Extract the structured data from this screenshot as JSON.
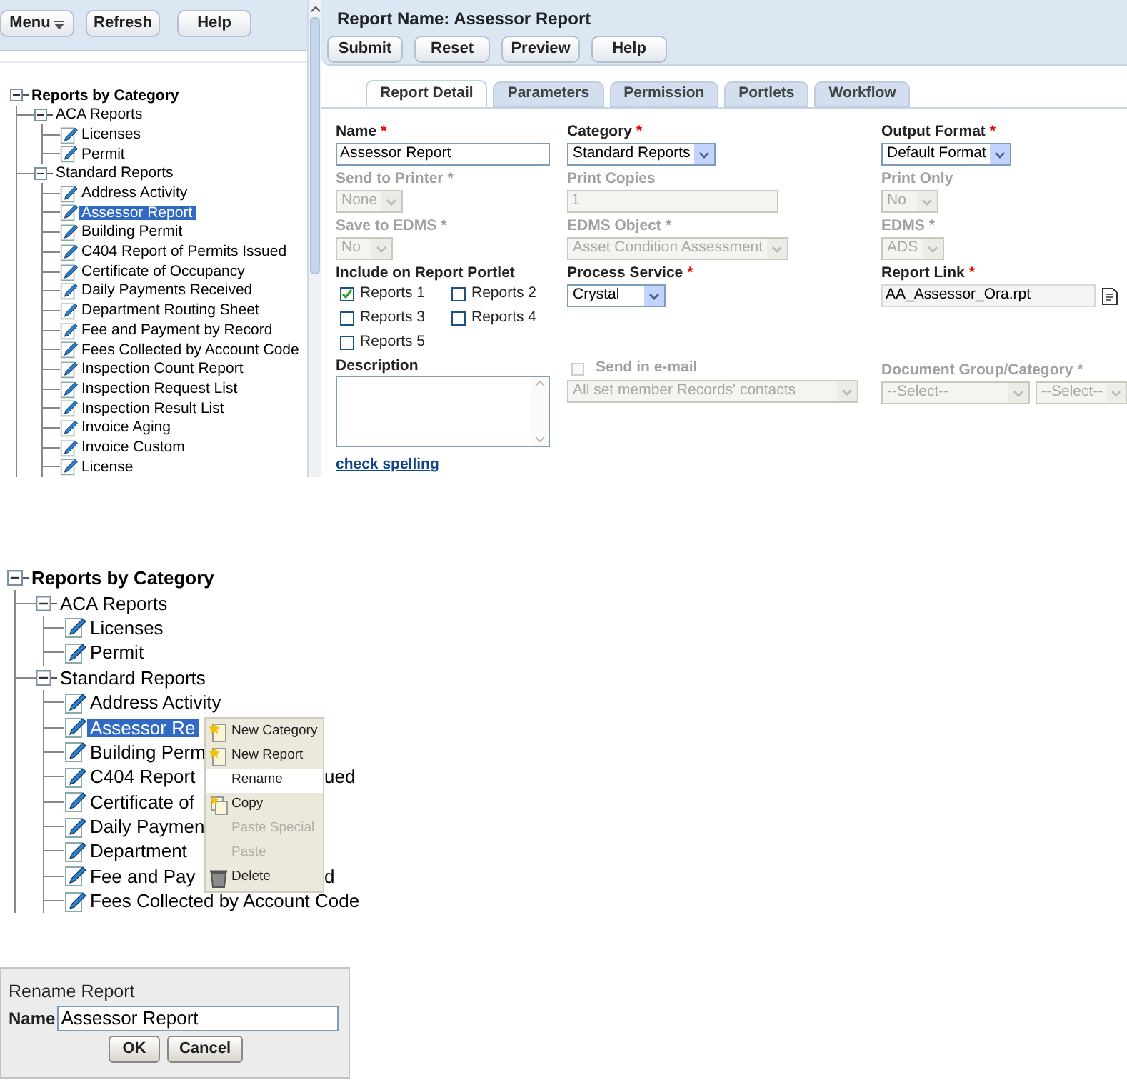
{
  "toolbar": [
    {
      "label": "Menu",
      "kind": "dropdown"
    },
    {
      "label": "Refresh",
      "kind": "button"
    },
    {
      "label": "Help",
      "kind": "button"
    }
  ],
  "tree": {
    "label": "Reports by Category",
    "expanded": true,
    "children": [
      {
        "label": "ACA Reports",
        "expanded": true,
        "children": [
          {
            "label": "Licenses",
            "selected": false
          },
          {
            "label": "Permit",
            "selected": false
          }
        ]
      },
      {
        "label": "Standard Reports",
        "expanded": true,
        "children": [
          {
            "label": "Address Activity",
            "selected": false
          },
          {
            "label": "Assessor Report",
            "selected": true
          },
          {
            "label": "Building Permit",
            "selected": false
          },
          {
            "label": "C404 Report of Permits Issued",
            "selected": false
          },
          {
            "label": "Certificate of Occupancy",
            "selected": false
          },
          {
            "label": "Daily Payments Received",
            "selected": false
          },
          {
            "label": "Department Routing Sheet",
            "selected": false
          },
          {
            "label": "Fee and Payment by Record",
            "selected": false
          },
          {
            "label": "Fees Collected by Account Code",
            "selected": false
          },
          {
            "label": "Inspection Count Report",
            "selected": false
          },
          {
            "label": "Inspection Request List",
            "selected": false
          },
          {
            "label": "Inspection Result List",
            "selected": false
          },
          {
            "label": "Invoice Aging",
            "selected": false
          },
          {
            "label": "Invoice Custom",
            "selected": false
          },
          {
            "label": "License",
            "selected": false
          }
        ]
      }
    ]
  },
  "report": {
    "title": "Report Name: Assessor Report",
    "buttons": [
      "Submit",
      "Reset",
      "Preview",
      "Help"
    ],
    "tabs": [
      {
        "label": "Report Detail",
        "selected": true
      },
      {
        "label": "Parameters",
        "selected": false
      },
      {
        "label": "Permission",
        "selected": false
      },
      {
        "label": "Portlets",
        "selected": false
      },
      {
        "label": "Workflow",
        "selected": false
      }
    ],
    "fields": [
      {
        "kind": "text",
        "label": "Name",
        "required_mark": "*",
        "disabled": false,
        "value": "Assessor Report"
      },
      {
        "kind": "select",
        "label": "Category",
        "required_mark": "*",
        "disabled": false,
        "value": "Standard Reports"
      },
      {
        "kind": "select",
        "label": "Output Format",
        "required_mark": "*",
        "disabled": false,
        "value": "Default Format"
      },
      {
        "kind": "select",
        "label": "Send to Printer",
        "required_mark": "*",
        "disabled": true,
        "value": "None"
      },
      {
        "kind": "text",
        "label": "Print Copies",
        "disabled": true,
        "value": "1"
      },
      {
        "kind": "select",
        "label": "Print Only",
        "disabled": true,
        "value": "No"
      },
      {
        "kind": "select",
        "label": "Save to EDMS",
        "required_mark": "*",
        "disabled": true,
        "value": "No"
      },
      {
        "kind": "select",
        "label": "EDMS Object",
        "required_mark": "*",
        "disabled": true,
        "value": "Asset Condition Assessment"
      },
      {
        "kind": "select",
        "label": "EDMS",
        "required_mark": "*",
        "disabled": true,
        "value": "ADS"
      },
      {
        "kind": "checkboxes",
        "label": "Include on Report Portlet",
        "options": [
          {
            "label": "Reports 1",
            "checked": true
          },
          {
            "label": "Reports 2",
            "checked": false
          },
          {
            "label": "Reports 3",
            "checked": false
          },
          {
            "label": "Reports 4",
            "checked": false
          },
          {
            "label": "Reports 5",
            "checked": false
          }
        ]
      },
      {
        "kind": "select",
        "label": "Process Service",
        "required_mark": "*",
        "disabled": false,
        "value": "Crystal"
      },
      {
        "kind": "file",
        "label": "Report Link",
        "required_mark": "*",
        "disabled": false,
        "value": "AA_Assessor_Ora.rpt"
      },
      {
        "kind": "textarea",
        "label": "Description",
        "disabled": false
      },
      {
        "kind": "email",
        "label": "Send in e-mail",
        "disabled": true,
        "checked": false,
        "value": "All set member Records' contacts"
      },
      {
        "kind": "double-select",
        "label": "Document Group/Category",
        "required_mark": "*",
        "disabled": true,
        "values": [
          "--Select--",
          "--Select--"
        ]
      }
    ],
    "link": "check spelling"
  },
  "context_tree": {
    "label": "Reports by Category",
    "expanded": true,
    "children": [
      {
        "label": "ACA Reports",
        "expanded": true,
        "children": [
          {
            "label": "Licenses",
            "selected": false
          },
          {
            "label": "Permit",
            "selected": false
          }
        ]
      },
      {
        "label": "Standard Reports",
        "expanded": true,
        "children": [
          {
            "label": "Address Activity",
            "selected": false
          },
          {
            "label": "Assessor Re",
            "selected": true
          },
          {
            "label": "Building Perm",
            "selected": false
          },
          {
            "label": "C404 Report",
            "tail": "ued",
            "selected": false
          },
          {
            "label": "Certificate of",
            "selected": false
          },
          {
            "label": "Daily Paymen",
            "selected": false
          },
          {
            "label": "Department",
            "selected": false
          },
          {
            "label": "Fee and Pay",
            "tail": "d",
            "selected": false
          },
          {
            "label": "Fees Collected by Account Code",
            "selected": false
          }
        ]
      }
    ]
  },
  "context_menu": [
    {
      "label": "New Category",
      "kind": "new",
      "disabled": false,
      "selected": false
    },
    {
      "label": "New Report",
      "kind": "new",
      "disabled": false,
      "selected": false
    },
    {
      "label": "Rename",
      "kind": "plain",
      "disabled": false,
      "selected": true
    },
    {
      "label": "Copy",
      "kind": "copy",
      "disabled": false,
      "selected": false
    },
    {
      "label": "Paste Special",
      "kind": "plain",
      "disabled": true,
      "selected": false
    },
    {
      "label": "Paste",
      "kind": "plain",
      "disabled": true,
      "selected": false
    },
    {
      "label": "Delete",
      "kind": "delete",
      "disabled": false,
      "selected": false
    }
  ],
  "dialog": {
    "title": "Rename Report",
    "field_label": "Name",
    "value": "Assessor Report",
    "buttons": [
      "OK",
      "Cancel"
    ]
  }
}
